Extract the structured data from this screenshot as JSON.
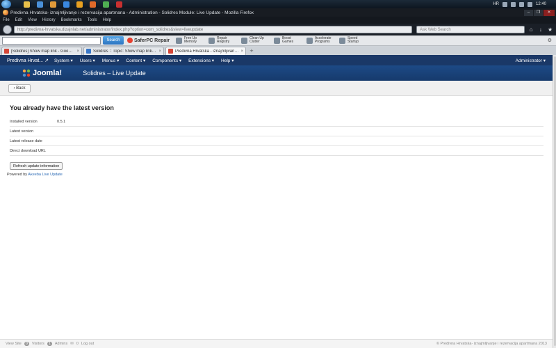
{
  "taskbar": {
    "lang": "HR",
    "time": "12:40"
  },
  "browser": {
    "title": "Predivna Hrvatska- iznajmljivanje i rezervacija apartmana - Administration - Solidres Module: Live Update - Mozilla Firefox",
    "menu": [
      "File",
      "Edit",
      "View",
      "History",
      "Bookmarks",
      "Tools",
      "Help"
    ],
    "url": "http://predivna-hrvatska.dizajnlab.net/administrator/index.php?option=com_solidres&view=liveupdate",
    "search_placeholder": "Ask Web Search",
    "toolbar": {
      "search_value": "",
      "search_button": "Search",
      "brand": "SaferPC Repair",
      "tools": [
        "Free Up Memory",
        "Repair Registry",
        "Clean Up Clutter",
        "Boost Games",
        "Accelerate Programs",
        "Speed Startup"
      ]
    },
    "tabs": [
      {
        "label": "[Solidres] Show map link - Google m...",
        "color": "#d44638",
        "active": false
      },
      {
        "label": "Solidres :: Topic: Show map link - Go...",
        "color": "#3a78c8",
        "active": false
      },
      {
        "label": "Predivna Hrvatska - iznajmljivanje i re...",
        "color": "#d44638",
        "active": true
      }
    ]
  },
  "joomla": {
    "site_name": "Predivna Hrvat...",
    "menu": [
      "System",
      "Users",
      "Menus",
      "Content",
      "Components",
      "Extensions",
      "Help"
    ],
    "admin": "Administrator",
    "logo": "Joomla!",
    "page_title": "Solidres – Live Update",
    "back_button": "Back"
  },
  "main": {
    "heading": "You already have the latest version",
    "rows": [
      {
        "label": "Installed version",
        "value": "0.5.1"
      },
      {
        "label": "Latest version",
        "value": ""
      },
      {
        "label": "Latest release date",
        "value": ""
      },
      {
        "label": "Direct download URL",
        "value": ""
      }
    ],
    "refresh_button": "Refresh update information",
    "powered_prefix": "Powered by",
    "powered_link": "Akeeba Live Update"
  },
  "statusbar": {
    "view_site": "View Site",
    "visitors_count": "0",
    "visitors": "Visitors",
    "admins_count": "1",
    "admins": "Admins",
    "messages_count": "0",
    "logout": "Log out",
    "copyright": "© Predivna Hrvatska- iznajmljivanje i rezervacija apartmana 2013"
  },
  "colors": {
    "joomla_menu": "#1a3867",
    "joomla_header": "#1d4a86",
    "link": "#2b6ab5"
  }
}
